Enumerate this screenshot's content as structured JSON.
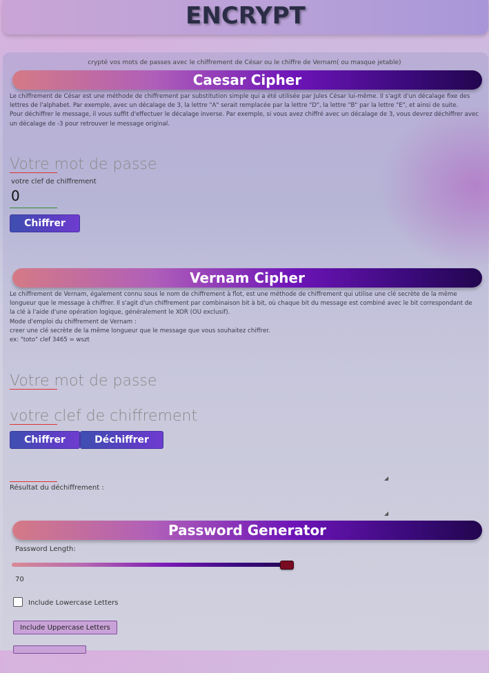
{
  "header": {
    "title": "ENCRYPT"
  },
  "tagline": "crypté vos mots de passes avec le chiffrement de César ou le chiffre de Vernam( ou masque jetable)",
  "caesar": {
    "title": "Caesar Cipher",
    "desc_1": "Le chiffrement de César est une méthode de chiffrement par substitution simple qui a été utilisée par Jules César lui-même. Il s'agit d'un décalage fixe des lettres de l'alphabet. Par exemple, avec un décalage de 3, la lettre \"A\" serait remplacée par la lettre \"D\", la lettre \"B\" par la lettre \"E\", et ainsi de suite.",
    "desc_2": "Pour déchiffrer le message, il vous suffit d'effectuer le décalage inverse. Par exemple, si vous avez chiffré avec un décalage de 3, vous devrez déchiffrer avec un décalage de -3 pour retrouver le message original.",
    "password_placeholder": "Votre mot de passe",
    "key_label": "votre clef de chiffrement",
    "key_value": "0",
    "encrypt_label": "Chiffrer"
  },
  "vernam": {
    "title": "Vernam Cipher",
    "desc_1": "Le chiffrement de Vernam, également connu sous le nom de chiffrement à flot, est une méthode de chiffrement qui utilise une clé secrète de la même longueur que le message à chiffrer. Il s'agit d'un chiffrement par combinaison bit à bit, où chaque bit du message est combiné avec le bit correspondant de la clé à l'aide d'une opération logique, généralement le XOR (OU exclusif).",
    "desc_2": "Mode d'emploi du chiffrement de Vernam :",
    "desc_3": "creer une clé secrète de la même longueur que le message que vous souhaitez chiffrer.",
    "desc_4": "ex: \"toto\" clef 3465 = wszt",
    "password_placeholder": "Votre mot de passe",
    "key_placeholder": "votre clef de chiffrement",
    "encrypt_label": "Chiffrer",
    "decrypt_label": "Déchiffrer",
    "result_label": "Résultat du déchiffrement :"
  },
  "generator": {
    "title": "Password Generator",
    "length_label": "Password Length:",
    "length_value": "70",
    "lowercase_label": "Include Lowercase Letters",
    "uppercase_label": "Include Uppercase Letters"
  }
}
